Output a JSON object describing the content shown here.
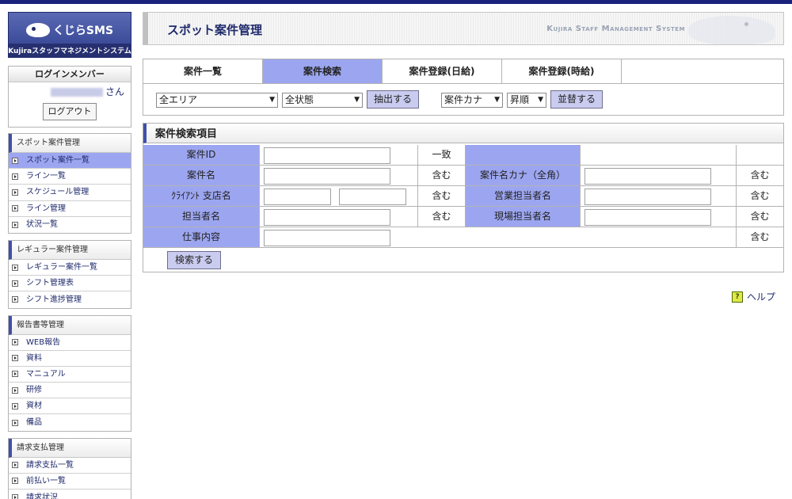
{
  "sidebar": {
    "logo_text": "くじらSMS",
    "logo_subtitle": "Kujiraスタッフマネジメントシステム",
    "login": {
      "title": "ログインメンバー",
      "user_suffix": "さん",
      "logout_label": "ログアウト"
    },
    "sections": [
      {
        "title": "スポット案件管理",
        "items": [
          "スポット案件一覧",
          "ライン一覧",
          "スケジュール管理",
          "ライン管理",
          "状況一覧"
        ]
      },
      {
        "title": "レギュラー案件管理",
        "items": [
          "レギュラー案件一覧",
          "シフト管理表",
          "シフト進捗管理"
        ]
      },
      {
        "title": "報告書等管理",
        "items": [
          "WEB報告",
          "資料",
          "マニュアル",
          "研修",
          "資材",
          "備品"
        ]
      },
      {
        "title": "請求支払管理",
        "items": [
          "請求支払一覧",
          "前払い一覧",
          "請求状況"
        ]
      }
    ],
    "active_item": "スポット案件一覧"
  },
  "header": {
    "title": "スポット案件管理",
    "system_name": "Kujira Staff Management System"
  },
  "tabs": [
    {
      "label": "案件一覧"
    },
    {
      "label": "案件検索"
    },
    {
      "label": "案件登録(日給)"
    },
    {
      "label": "案件登録(時給)"
    }
  ],
  "active_tab": "案件検索",
  "filter": {
    "area": "全エリア",
    "status": "全状態",
    "extract_label": "抽出する",
    "sort_field": "案件カナ",
    "sort_order": "昇順",
    "sort_label": "並替する"
  },
  "search": {
    "title": "案件検索項目",
    "rows": [
      {
        "left_label": "案件ID",
        "left_mode": "一致",
        "right_label": "",
        "right_mode": ""
      },
      {
        "left_label": "案件名",
        "left_mode": "含む",
        "right_label": "案件名カナ（全角）",
        "right_mode": "含む"
      },
      {
        "left_label": "ｸﾗｲｱﾝﾄ 支店名",
        "left_mode": "含む",
        "right_label": "営業担当者名",
        "right_mode": "含む"
      },
      {
        "left_label": "担当者名",
        "left_mode": "含む",
        "right_label": "現場担当者名",
        "right_mode": "含む"
      },
      {
        "left_label": "仕事内容",
        "left_mode": "含む",
        "right_label": "",
        "right_mode": ""
      }
    ],
    "submit_label": "検索する"
  },
  "help": {
    "icon": "help-icon",
    "label": "ヘルプ"
  },
  "colors": {
    "accent": "#9ca6f0",
    "nav_dark": "#1a237e",
    "text_link": "#1f2a6b"
  }
}
